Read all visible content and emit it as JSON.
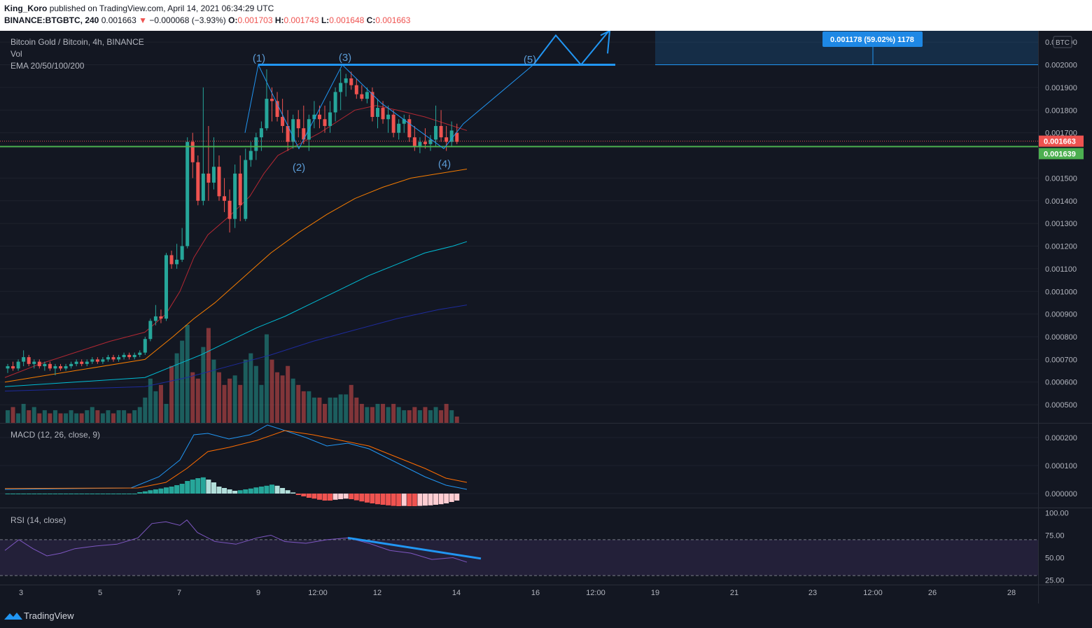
{
  "header": {
    "publisher": "King_Koro",
    "published_text": "published on TradingView.com, April 14, 2021 06:34:29 UTC",
    "symbol": "BINANCE:BTGBTC, 240",
    "last": "0.001663",
    "change": "−0.000068 (−3.93%)",
    "open_label": "O:",
    "open": "0.001703",
    "high_label": "H:",
    "high": "0.001743",
    "low_label": "L:",
    "low": "0.001648",
    "close_label": "C:",
    "close": "0.001663"
  },
  "legend": {
    "title": "Bitcoin Gold / Bitcoin, 4h, BINANCE",
    "vol": "Vol",
    "ema": "EMA 20/50/100/200",
    "macd": "MACD (12, 26, close, 9)",
    "rsi": "RSI (14, close)"
  },
  "footer": {
    "brand": "TradingView"
  },
  "colors": {
    "bg": "#131722",
    "up": "#26a69a",
    "down": "#ef5350",
    "ema20": "#b22833",
    "ema50": "#f57c00",
    "ema100": "#00bcd4",
    "ema200": "#1e2b9c",
    "pattern": "#2196f3",
    "support": "#4caf50",
    "macd": "#2196f3",
    "signal": "#ff6d00",
    "rsi": "#7e57c2"
  },
  "chart_data": {
    "type": "candlestick",
    "title": "Bitcoin Gold / Bitcoin, 4h, BINANCE",
    "currency": "BTC",
    "price_axis": {
      "labels": [
        "0.002100",
        "0.002000",
        "0.001900",
        "0.001800",
        "0.001700",
        "0.001500",
        "0.001400",
        "0.001300",
        "0.001200",
        "0.001100",
        "0.001000",
        "0.000900",
        "0.000800",
        "0.000700",
        "0.000600",
        "0.000500"
      ],
      "ylim": [
        0.00042,
        0.00215
      ]
    },
    "time_axis": [
      "3",
      "5",
      "7",
      "9",
      "12:00",
      "12",
      "14",
      "16",
      "12:00",
      "19",
      "21",
      "23",
      "12:00",
      "26",
      "28"
    ],
    "price_badges": [
      {
        "label": "0.001663",
        "value": 0.001663,
        "color": "#ef5350"
      },
      {
        "label": "0.001639",
        "value": 0.001639,
        "color": "#4caf50"
      }
    ],
    "support_level": 0.001639,
    "target_level": 0.002,
    "projection_box": {
      "label": "0.001178 (59.02%) 1178"
    },
    "wave_labels": [
      "(1)",
      "(2)",
      "(3)",
      "(4)",
      "(5)"
    ],
    "candles": [
      [
        0.00066,
        0.00068,
        0.00064,
        0.00067
      ],
      [
        0.00067,
        0.00069,
        0.00065,
        0.00066
      ],
      [
        0.00066,
        0.0007,
        0.00065,
        0.00069
      ],
      [
        0.00069,
        0.00074,
        0.00067,
        0.00071
      ],
      [
        0.00071,
        0.00072,
        0.00067,
        0.00068
      ],
      [
        0.00068,
        0.0007,
        0.00066,
        0.00069
      ],
      [
        0.00069,
        0.0007,
        0.00066,
        0.00067
      ],
      [
        0.00067,
        0.00069,
        0.00065,
        0.00068
      ],
      [
        0.00068,
        0.00069,
        0.00065,
        0.00066
      ],
      [
        0.00066,
        0.00068,
        0.00063,
        0.00067
      ],
      [
        0.00067,
        0.00068,
        0.00065,
        0.00066
      ],
      [
        0.00066,
        0.00068,
        0.00065,
        0.00067
      ],
      [
        0.00067,
        0.00069,
        0.00066,
        0.00068
      ],
      [
        0.00068,
        0.0007,
        0.00067,
        0.00069
      ],
      [
        0.00069,
        0.0007,
        0.00067,
        0.00068
      ],
      [
        0.00068,
        0.0007,
        0.00067,
        0.00069
      ],
      [
        0.00069,
        0.00071,
        0.00068,
        0.0007
      ],
      [
        0.0007,
        0.00071,
        0.00068,
        0.00069
      ],
      [
        0.00069,
        0.00071,
        0.00068,
        0.0007
      ],
      [
        0.0007,
        0.00072,
        0.00069,
        0.00071
      ],
      [
        0.00071,
        0.00072,
        0.00069,
        0.0007
      ],
      [
        0.0007,
        0.00072,
        0.00069,
        0.00071
      ],
      [
        0.00071,
        0.00073,
        0.0007,
        0.00072
      ],
      [
        0.00072,
        0.00073,
        0.0007,
        0.00071
      ],
      [
        0.00071,
        0.00073,
        0.0007,
        0.00072
      ],
      [
        0.00072,
        0.00074,
        0.00071,
        0.00073
      ],
      [
        0.00073,
        0.0008,
        0.00072,
        0.00079
      ],
      [
        0.00079,
        0.00088,
        0.00078,
        0.00087
      ],
      [
        0.00087,
        0.00094,
        0.00085,
        0.00089
      ],
      [
        0.00089,
        0.00092,
        0.00086,
        0.00088
      ],
      [
        0.00088,
        0.00117,
        0.00087,
        0.00116
      ],
      [
        0.00116,
        0.00118,
        0.0011,
        0.00112
      ],
      [
        0.00112,
        0.00121,
        0.0011,
        0.00114
      ],
      [
        0.00114,
        0.00128,
        0.00113,
        0.0012
      ],
      [
        0.0012,
        0.00168,
        0.00119,
        0.00166
      ],
      [
        0.00166,
        0.0017,
        0.0015,
        0.00157
      ],
      [
        0.00157,
        0.0016,
        0.00138,
        0.0014
      ],
      [
        0.0014,
        0.0019,
        0.00138,
        0.00152
      ],
      [
        0.00152,
        0.00173,
        0.0014,
        0.00148
      ],
      [
        0.00148,
        0.00168,
        0.00145,
        0.00155
      ],
      [
        0.00155,
        0.0016,
        0.0014,
        0.00142
      ],
      [
        0.00142,
        0.0015,
        0.00135,
        0.0014
      ],
      [
        0.0014,
        0.00145,
        0.00126,
        0.00132
      ],
      [
        0.00132,
        0.00156,
        0.00128,
        0.00152
      ],
      [
        0.00152,
        0.0016,
        0.00131,
        0.00138
      ],
      [
        0.00132,
        0.00163,
        0.00131,
        0.00158
      ],
      [
        0.00158,
        0.00166,
        0.00155,
        0.00162
      ],
      [
        0.00162,
        0.0017,
        0.00158,
        0.00168
      ],
      [
        0.00168,
        0.00175,
        0.00162,
        0.00172
      ],
      [
        0.00172,
        0.00198,
        0.00171,
        0.00185
      ],
      [
        0.00185,
        0.0019,
        0.00175,
        0.00184
      ],
      [
        0.00184,
        0.00188,
        0.00175,
        0.00177
      ],
      [
        0.00177,
        0.00185,
        0.0017,
        0.00173
      ],
      [
        0.00173,
        0.0018,
        0.00162,
        0.00166
      ],
      [
        0.00166,
        0.00178,
        0.00163,
        0.00176
      ],
      [
        0.00176,
        0.0018,
        0.00168,
        0.00172
      ],
      [
        0.00172,
        0.00182,
        0.00165,
        0.00167
      ],
      [
        0.00167,
        0.00178,
        0.00162,
        0.00176
      ],
      [
        0.00176,
        0.00184,
        0.00172,
        0.00178
      ],
      [
        0.00178,
        0.00182,
        0.00172,
        0.00176
      ],
      [
        0.00176,
        0.00182,
        0.0017,
        0.00173
      ],
      [
        0.00173,
        0.00184,
        0.0017,
        0.00179
      ],
      [
        0.00179,
        0.0019,
        0.00175,
        0.00188
      ],
      [
        0.00188,
        0.00198,
        0.0018,
        0.00192
      ],
      [
        0.00192,
        0.00196,
        0.00186,
        0.00194
      ],
      [
        0.00194,
        0.00197,
        0.00189,
        0.00191
      ],
      [
        0.00191,
        0.00194,
        0.00185,
        0.00187
      ],
      [
        0.00187,
        0.00191,
        0.00184,
        0.00185
      ],
      [
        0.00185,
        0.0019,
        0.00183,
        0.00188
      ],
      [
        0.00188,
        0.0019,
        0.00175,
        0.00177
      ],
      [
        0.00177,
        0.00185,
        0.00172,
        0.00181
      ],
      [
        0.00181,
        0.00184,
        0.00174,
        0.00176
      ],
      [
        0.00176,
        0.00182,
        0.0017,
        0.00178
      ],
      [
        0.00178,
        0.0018,
        0.00168,
        0.0017
      ],
      [
        0.0017,
        0.00176,
        0.00167,
        0.00174
      ],
      [
        0.00174,
        0.00178,
        0.0017,
        0.00176
      ],
      [
        0.00176,
        0.00178,
        0.00166,
        0.00168
      ],
      [
        0.00168,
        0.00173,
        0.00162,
        0.00164
      ],
      [
        0.00164,
        0.00168,
        0.00161,
        0.00166
      ],
      [
        0.00166,
        0.00172,
        0.00163,
        0.00165
      ],
      [
        0.00165,
        0.00169,
        0.00162,
        0.00167
      ],
      [
        0.00167,
        0.00182,
        0.00164,
        0.00173
      ],
      [
        0.00173,
        0.0018,
        0.00166,
        0.00168
      ],
      [
        0.00168,
        0.00173,
        0.00162,
        0.00166
      ],
      [
        0.00166,
        0.00175,
        0.00164,
        0.00171
      ],
      [
        0.0017,
        0.00174,
        0.00165,
        0.00166
      ]
    ],
    "volume": [
      4,
      5,
      3,
      6,
      4,
      5,
      3,
      4,
      3,
      4,
      3,
      3,
      4,
      3,
      3,
      4,
      5,
      4,
      3,
      4,
      3,
      4,
      4,
      3,
      4,
      5,
      8,
      14,
      10,
      12,
      6,
      18,
      22,
      26,
      31,
      16,
      14,
      24,
      30,
      20,
      16,
      12,
      14,
      15,
      12,
      20,
      22,
      18,
      12,
      28,
      20,
      16,
      15,
      18,
      14,
      12,
      10,
      10,
      8,
      8,
      6,
      8,
      8,
      9,
      9,
      12,
      8,
      6,
      5,
      5,
      6,
      6,
      5,
      6,
      5,
      4,
      4,
      5,
      4,
      5,
      4,
      5,
      4,
      6,
      4,
      2
    ],
    "ema": {
      "ema20": [
        [
          0,
          0.00062
        ],
        [
          50,
          0.00068
        ],
        [
          100,
          0.00073
        ],
        [
          150,
          0.00078
        ],
        [
          200,
          0.00082
        ],
        [
          230,
          0.0009
        ],
        [
          250,
          0.001
        ],
        [
          270,
          0.00115
        ],
        [
          290,
          0.00125
        ],
        [
          320,
          0.00133
        ],
        [
          350,
          0.00142
        ],
        [
          370,
          0.00152
        ],
        [
          390,
          0.0016
        ],
        [
          420,
          0.00165
        ],
        [
          450,
          0.0017
        ],
        [
          480,
          0.00176
        ],
        [
          500,
          0.0018
        ],
        [
          530,
          0.00182
        ],
        [
          560,
          0.0018
        ],
        [
          600,
          0.00177
        ],
        [
          630,
          0.00174
        ],
        [
          660,
          0.00171
        ]
      ],
      "ema50": [
        [
          0,
          0.0006
        ],
        [
          100,
          0.00065
        ],
        [
          200,
          0.0007
        ],
        [
          240,
          0.0008
        ],
        [
          270,
          0.00088
        ],
        [
          300,
          0.00095
        ],
        [
          340,
          0.00106
        ],
        [
          380,
          0.00117
        ],
        [
          420,
          0.00126
        ],
        [
          460,
          0.00134
        ],
        [
          500,
          0.00141
        ],
        [
          540,
          0.00146
        ],
        [
          580,
          0.0015
        ],
        [
          620,
          0.00152
        ],
        [
          660,
          0.00154
        ]
      ],
      "ema100": [
        [
          0,
          0.00058
        ],
        [
          100,
          0.0006
        ],
        [
          200,
          0.00062
        ],
        [
          240,
          0.00067
        ],
        [
          280,
          0.00072
        ],
        [
          320,
          0.00078
        ],
        [
          360,
          0.00084
        ],
        [
          400,
          0.00089
        ],
        [
          440,
          0.00095
        ],
        [
          480,
          0.00101
        ],
        [
          520,
          0.00107
        ],
        [
          560,
          0.00112
        ],
        [
          600,
          0.00117
        ],
        [
          640,
          0.0012
        ],
        [
          660,
          0.00122
        ]
      ],
      "ema200": [
        [
          0,
          0.00056
        ],
        [
          100,
          0.00057
        ],
        [
          200,
          0.00058
        ],
        [
          260,
          0.00062
        ],
        [
          320,
          0.00067
        ],
        [
          380,
          0.00072
        ],
        [
          440,
          0.00078
        ],
        [
          500,
          0.00083
        ],
        [
          560,
          0.00088
        ],
        [
          620,
          0.00092
        ],
        [
          660,
          0.00094
        ]
      ]
    },
    "macd": {
      "ylim": [
        -5e-05,
        0.00025
      ],
      "labels": [
        "0.000200",
        "0.000100",
        "0.000000"
      ],
      "histogram": [
        0,
        0,
        0,
        0,
        0,
        0,
        0,
        0,
        0,
        0,
        0,
        0,
        0,
        0,
        0,
        0,
        0,
        0,
        0,
        0,
        0,
        0,
        0,
        0,
        0,
        5e-06,
        8e-06,
        1.2e-05,
        1.5e-05,
        1.8e-05,
        2.2e-05,
        2.5e-05,
        3e-05,
        3.5e-05,
        4.5e-05,
        5e-05,
        5.5e-05,
        5.8e-05,
        5e-05,
        4e-05,
        2.5e-05,
        2e-05,
        1.5e-05,
        1e-05,
        1.2e-05,
        1.5e-05,
        1.8e-05,
        2.2e-05,
        2.5e-05,
        2.8e-05,
        3.2e-05,
        2.8e-05,
        2e-05,
        1.2e-05,
        4e-06,
        -5e-06,
        -1e-05,
        -1.5e-05,
        -1.8e-05,
        -2.2e-05,
        -2.5e-05,
        -2.5e-05,
        -2.2e-05,
        -2e-05,
        -1.8e-05,
        -2e-05,
        -2.4e-05,
        -2.8e-05,
        -3.2e-05,
        -3.5e-05,
        -3.8e-05,
        -4e-05,
        -4.2e-05,
        -4.4e-05,
        -4.5e-05,
        -4.4e-05,
        -4.5e-05,
        -4.5e-05,
        -4.4e-05,
        -4.3e-05,
        -4.2e-05,
        -4e-05,
        -3.8e-05,
        -3.5e-05,
        -3e-05,
        -2.5e-05
      ],
      "macd_line": [
        [
          0,
          1.5e-05
        ],
        [
          180,
          2e-05
        ],
        [
          220,
          6e-05
        ],
        [
          250,
          0.00012
        ],
        [
          270,
          0.00021
        ],
        [
          290,
          0.000215
        ],
        [
          320,
          0.000195
        ],
        [
          350,
          0.00021
        ],
        [
          375,
          0.000245
        ],
        [
          400,
          0.000225
        ],
        [
          430,
          0.0002
        ],
        [
          460,
          0.00017
        ],
        [
          490,
          0.00018
        ],
        [
          520,
          0.00016
        ],
        [
          560,
          0.00011
        ],
        [
          600,
          6e-05
        ],
        [
          630,
          3e-05
        ],
        [
          660,
          1.5e-05
        ]
      ],
      "signal_line": [
        [
          0,
          1.8e-05
        ],
        [
          190,
          2e-05
        ],
        [
          230,
          4e-05
        ],
        [
          260,
          9e-05
        ],
        [
          290,
          0.00015
        ],
        [
          320,
          0.000165
        ],
        [
          360,
          0.00019
        ],
        [
          400,
          0.000225
        ],
        [
          440,
          0.00021
        ],
        [
          480,
          0.00019
        ],
        [
          520,
          0.00017
        ],
        [
          560,
          0.00013
        ],
        [
          600,
          9e-05
        ],
        [
          630,
          5.5e-05
        ],
        [
          660,
          4e-05
        ]
      ]
    },
    "rsi": {
      "ylim": [
        20,
        105
      ],
      "labels": [
        "100.00",
        "75.00",
        "50.00",
        "25.00"
      ],
      "upper_band": 70,
      "lower_band": 30,
      "values": [
        [
          0,
          58
        ],
        [
          20,
          70
        ],
        [
          40,
          60
        ],
        [
          60,
          52
        ],
        [
          80,
          55
        ],
        [
          100,
          60
        ],
        [
          130,
          63
        ],
        [
          160,
          65
        ],
        [
          190,
          72
        ],
        [
          210,
          88
        ],
        [
          230,
          90
        ],
        [
          250,
          86
        ],
        [
          260,
          92
        ],
        [
          275,
          78
        ],
        [
          300,
          68
        ],
        [
          330,
          65
        ],
        [
          360,
          72
        ],
        [
          380,
          75
        ],
        [
          400,
          68
        ],
        [
          430,
          66
        ],
        [
          460,
          70
        ],
        [
          490,
          72
        ],
        [
          520,
          66
        ],
        [
          550,
          58
        ],
        [
          580,
          55
        ],
        [
          610,
          48
        ],
        [
          640,
          50
        ],
        [
          660,
          45
        ]
      ],
      "trendline": [
        [
          490,
          72
        ],
        [
          680,
          49
        ]
      ]
    }
  }
}
